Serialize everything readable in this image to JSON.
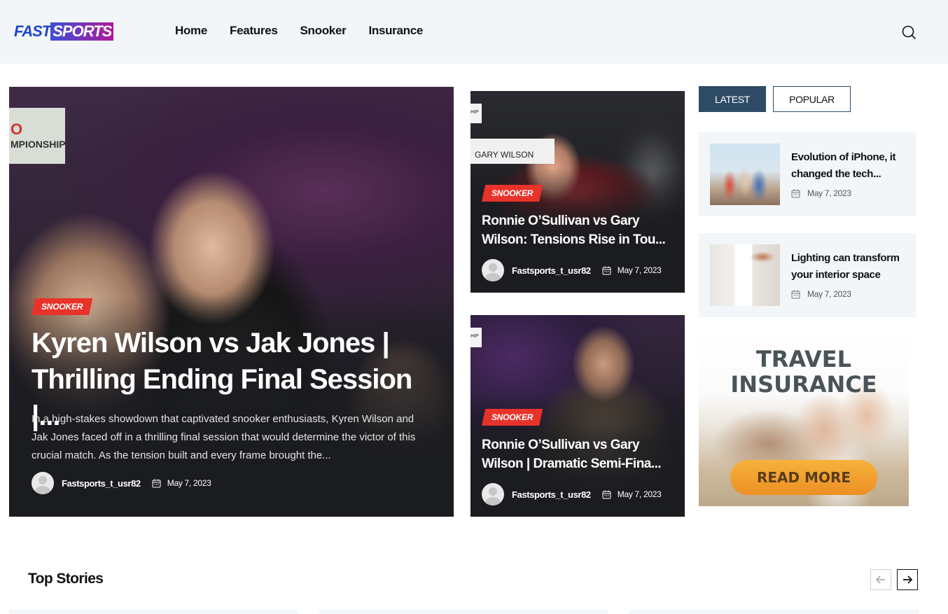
{
  "header": {
    "logo_fast": "FAST",
    "logo_sports": "SPORTS",
    "nav": [
      "Home",
      "Features",
      "Snooker",
      "Insurance"
    ]
  },
  "hero": {
    "sign_text": "O\nMPIONSHIP",
    "category": "SNOOKER",
    "title": "Kyren Wilson vs Jak Jones | Thrilling Ending Final Session |...",
    "excerpt": "In a high-stakes showdown that captivated snooker enthusiasts, Kyren Wilson and Jak Jones faced off in a thrilling final session that would determine the victor of this crucial match. As the tension built and every frame brought the...",
    "author": "Fastsports_t_usr82",
    "date": "May 7, 2023"
  },
  "cards": [
    {
      "name_plate": "GARY WILSON",
      "side_tag": "HIP",
      "category": "SNOOKER",
      "title": "Ronnie O’Sullivan vs Gary\nWilson: Tensions Rise in Tou...",
      "author": "Fastsports_t_usr82",
      "date": "May 7, 2023"
    },
    {
      "side_tag": "HIP",
      "category": "SNOOKER",
      "title": "Ronnie O’Sullivan vs Gary\nWilson | Dramatic Semi-Fina...",
      "author": "Fastsports_t_usr82",
      "date": "May 7, 2023"
    }
  ],
  "tabs": {
    "latest": "LATEST",
    "popular": "POPULAR"
  },
  "posts": [
    {
      "title": "Evolution of iPhone, it changed the tech...",
      "date": "May 7, 2023"
    },
    {
      "title": "Lighting can transform your interior space",
      "date": "May 7, 2023"
    }
  ],
  "ad": {
    "line1": "TRAVEL",
    "line2": "INSURANCE",
    "button": "READ MORE"
  },
  "top_stories": {
    "title": "Top Stories"
  },
  "colors": {
    "accent_badge": "#e8332a",
    "tab_active": "#2e4b66",
    "header_bg": "#f2f6f9",
    "card_bg": "#1b1c20"
  }
}
